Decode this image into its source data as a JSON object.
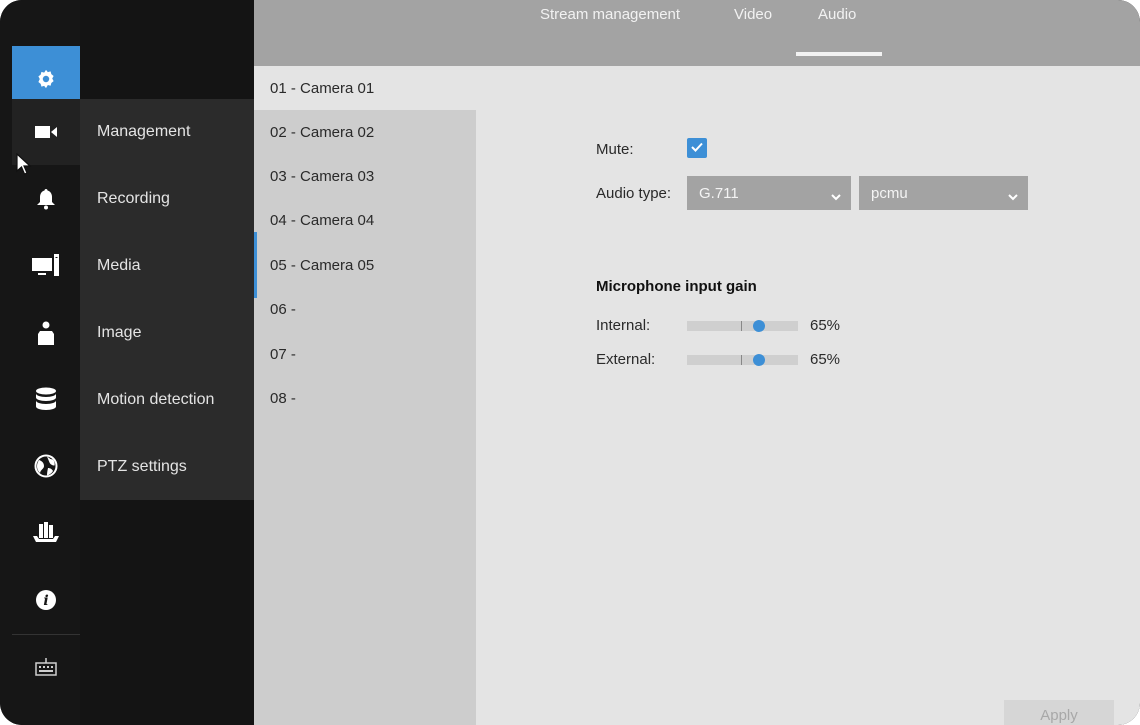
{
  "topbar": {
    "tabs": [
      {
        "label": "Stream management"
      },
      {
        "label": "Video"
      },
      {
        "label": "Audio"
      }
    ],
    "active_tab": "Audio"
  },
  "icon_rail": {
    "items": [
      {
        "icon": "gear-icon",
        "active": true
      },
      {
        "icon": "camera-icon"
      },
      {
        "icon": "bell-icon"
      },
      {
        "icon": "monitor-icon"
      },
      {
        "icon": "person-icon"
      },
      {
        "icon": "database-icon"
      },
      {
        "icon": "globe-icon"
      },
      {
        "icon": "books-icon"
      },
      {
        "icon": "info-icon"
      },
      {
        "icon": "keyboard-icon"
      }
    ]
  },
  "submenu": {
    "items": [
      {
        "label": "Management"
      },
      {
        "label": "Recording"
      },
      {
        "label": "Media"
      },
      {
        "label": "Image"
      },
      {
        "label": "Motion detection"
      },
      {
        "label": "PTZ settings"
      }
    ]
  },
  "cameras": {
    "items": [
      {
        "label": "01 - Camera 01"
      },
      {
        "label": "02 - Camera 02"
      },
      {
        "label": "03 - Camera 03"
      },
      {
        "label": "04 - Camera 04"
      },
      {
        "label": "05 - Camera 05"
      },
      {
        "label": "06 -"
      },
      {
        "label": "07 -"
      },
      {
        "label": "08 -"
      }
    ],
    "selected": "01 - Camera 01"
  },
  "audio": {
    "mute_label": "Mute:",
    "mute_checked": true,
    "type_label": "Audio type:",
    "codec_value": "G.711",
    "mode_value": "pcmu",
    "gain_heading": "Microphone input gain",
    "internal_label": "Internal:",
    "internal_value": "65%",
    "internal_level": 0.65,
    "external_label": "External:",
    "external_value": "65%",
    "external_level": 0.65
  },
  "actions": {
    "apply_label": "Apply"
  },
  "colors": {
    "accent": "#3d8fd6",
    "topbar": "#a3a3a3",
    "panel": "#e4e4e4",
    "rail": "#161616"
  }
}
